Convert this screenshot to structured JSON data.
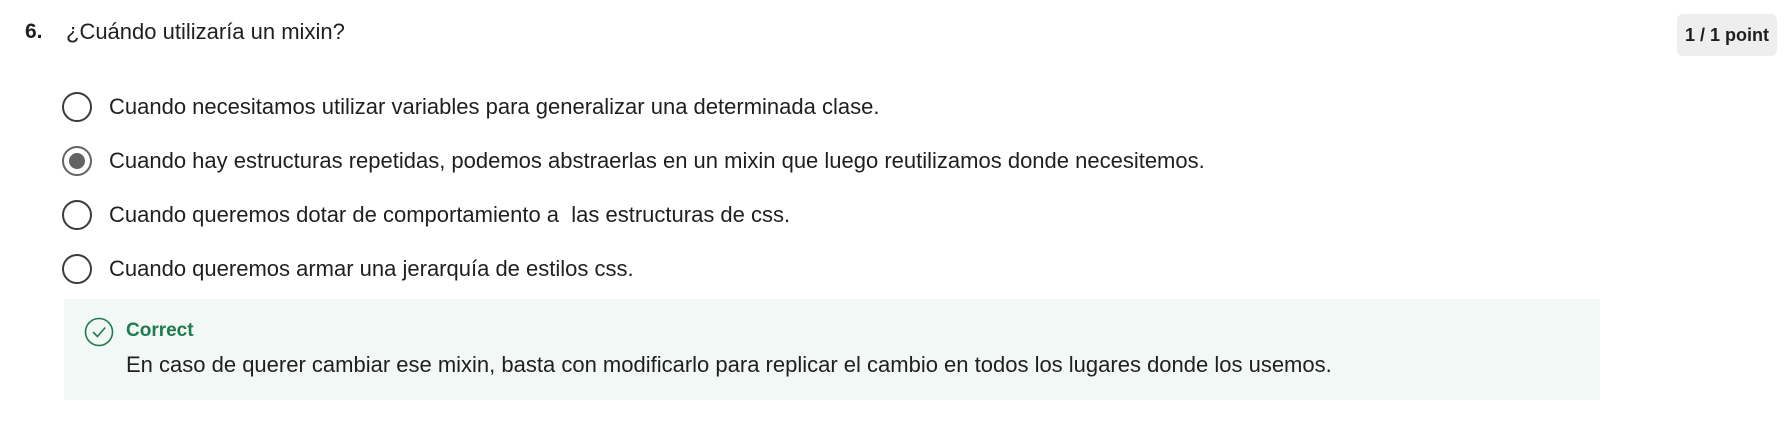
{
  "question": {
    "number": "6.",
    "text": "¿Cuándo utilizaría un mixin?",
    "points": "1 / 1 point"
  },
  "options": [
    {
      "label": "Cuando necesitamos utilizar variables para generalizar una determinada clase.",
      "selected": false
    },
    {
      "label": "Cuando hay estructuras repetidas, podemos abstraerlas en un mixin que luego reutilizamos donde necesitemos.",
      "selected": true
    },
    {
      "label": "Cuando queremos dotar de comportamiento a  las estructuras de css.",
      "selected": false
    },
    {
      "label": "Cuando queremos armar una jerarquía de estilos css.",
      "selected": false
    }
  ],
  "feedback": {
    "status": "Correct",
    "message": "En caso de querer cambiar ese mixin, basta con modificarlo para replicar el cambio en todos los lugares donde los usemos.",
    "icon": "check-circle-icon",
    "color": "#1e7a4f",
    "background": "#f2f8f5"
  }
}
